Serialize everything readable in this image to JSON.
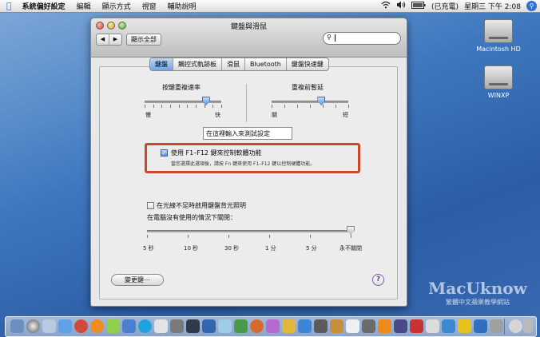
{
  "menubar": {
    "app": "系統偏好設定",
    "items": [
      "編輯",
      "顯示方式",
      "視窗",
      "輔助說明"
    ],
    "battery": "(已充電)",
    "clock": "星期三 下午 2:08"
  },
  "desktop": {
    "icons": [
      {
        "label": "Macintosh HD"
      },
      {
        "label": "WINXP"
      }
    ]
  },
  "window": {
    "title": "鍵盤與滑鼠",
    "show_all": "顯示全部",
    "search_placeholder": "",
    "tabs": [
      {
        "label": "鍵盤",
        "selected": true
      },
      {
        "label": "觸控式軌跡板"
      },
      {
        "label": "滑鼠"
      },
      {
        "label": "Bluetooth"
      },
      {
        "label": "鍵盤快速鍵"
      }
    ],
    "key_repeat": {
      "title": "按鍵重複速率",
      "min_label": "慢",
      "max_label": "快",
      "value": 0.8
    },
    "delay": {
      "title": "重複前暫延",
      "min_label": "關",
      "max_label": "短",
      "value": 0.65
    },
    "test_field": "在這裡輸入來測試設定",
    "fn_option": {
      "label": "使用 F1–F12 鍵來控制軟體功能",
      "checked": true,
      "description": "當您選擇此選項後，請按 Fn 鍵來使用 F1–F12 鍵以控制硬體功能。"
    },
    "backlight": {
      "label": "在光線不足時啟用鍵盤背光照明",
      "checked": false
    },
    "turn_off": {
      "label": "在電腦沒有使用的情況下關閉：",
      "ticks": [
        "5 秒",
        "10 秒",
        "30 秒",
        "1 分",
        "5 分",
        "永不關閉"
      ],
      "value": 1.0
    },
    "modifier_button": "變更鍵⋯"
  },
  "watermark": {
    "title": "MacUknow",
    "subtitle": "繁體中文蘋果教學網站"
  },
  "colors": {
    "highlight_box": "#c9472a",
    "selected_tab": "#6ea4e6"
  }
}
